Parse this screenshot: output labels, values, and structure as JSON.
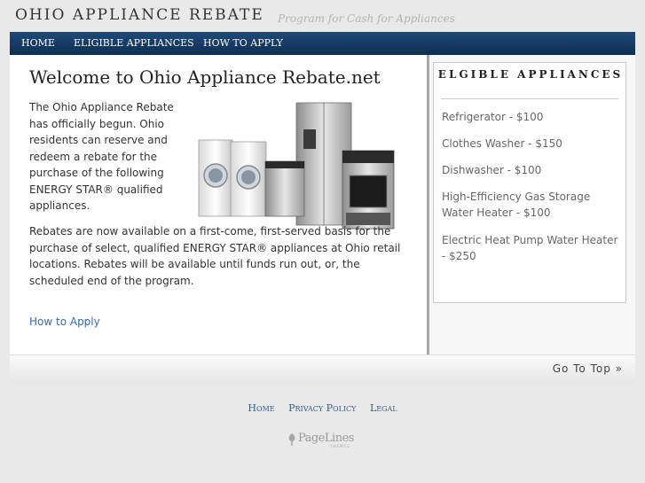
{
  "header": {
    "title": "OHIO APPLIANCE REBATE",
    "tagline": "Program for Cash for Appliances"
  },
  "nav": {
    "items": [
      {
        "label": "HOME"
      },
      {
        "label": "ELIGIBLE APPLIANCES"
      },
      {
        "label": "HOW TO APPLY"
      }
    ]
  },
  "main": {
    "heading": "Welcome to Ohio Appliance Rebate.net",
    "intro": "The Ohio Appliance Rebate has officially begun. Ohio residents can reserve and redeem a rebate for the purchase of the following ENERGY STAR® qualified appliances.",
    "para2": "Rebates are now available on a first-come, first-served basis for the purchase of select, qualified ENERGY STAR® appliances at Ohio retail locations. Rebates will be available until funds run out, or, the scheduled end of the program.",
    "how_to_apply_link": "How to Apply"
  },
  "sidebar": {
    "title": "ELGIBLE APPLIANCES",
    "items": [
      {
        "label": "Refrigerator - $100"
      },
      {
        "label": "Clothes Washer - $150"
      },
      {
        "label": "Dishwasher - $100"
      },
      {
        "label": "High-Efficiency Gas Storage Water Heater - $100"
      },
      {
        "label": "Electric Heat Pump Water Heater - $250"
      }
    ]
  },
  "footer": {
    "go_to_top": "Go To Top »",
    "links": [
      {
        "label": "Home"
      },
      {
        "label": "Privacy Policy"
      },
      {
        "label": "Legal"
      }
    ],
    "logo_text": "PageLines",
    "logo_subtext": "THEMES"
  },
  "colors": {
    "nav_bg": "#173d66",
    "link": "#3a6aa8",
    "footer_link": "#2e5c8f"
  }
}
